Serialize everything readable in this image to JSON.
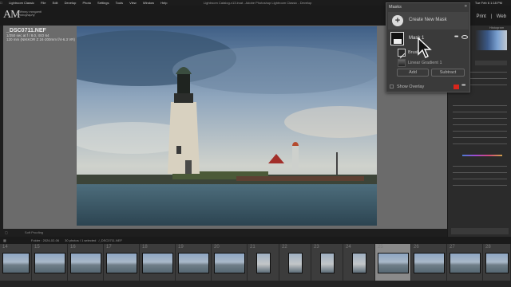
{
  "menubar": {
    "items": [
      "Lightroom Classic",
      "File",
      "Edit",
      "Develop",
      "Photo",
      "Settings",
      "Tools",
      "View",
      "Window",
      "Help"
    ],
    "window_title": "Lightroom Catalog-v13.lrcat - Adobe Photoshop Lightroom Classic - Develop",
    "clock": "Tue Feb 6  1:18 PM"
  },
  "identity": {
    "logo_letters": "AM",
    "logo_line1": "anthony morganti",
    "logo_line2": "Photography"
  },
  "modules": {
    "print": "Print",
    "web": "Web"
  },
  "info_overlay": {
    "filename": "_DSC0711.NEF",
    "exposure": "1/250 sec at f / 8.0, ISO 64",
    "lens": "120 mm (NIKKOR Z 24-200mm f/4-6.3 VR)"
  },
  "masks_panel": {
    "title": "Masks",
    "create_label": "Create New Mask",
    "mask_label": "Mask 1",
    "brush_label": "Brush",
    "linear_label": "Linear Gradient 1",
    "add_label": "Add",
    "subtract_label": "Subtract",
    "show_overlay_label": "Show Overlay",
    "overlay_color": "#d9261c"
  },
  "right_panel": {
    "histogram_label": "Histogram"
  },
  "toolbar": {
    "soft_proof": "Soft Proofing"
  },
  "filmstrip_bar": {
    "folder": "Folder : 2024-02-06",
    "count": "30 photos / 1 selected",
    "current": "/_DSC0711.NEF"
  },
  "filmstrip": {
    "numbers": [
      "14",
      "15",
      "16",
      "17",
      "18",
      "19",
      "20",
      "21",
      "22",
      "23",
      "24",
      "25",
      "26",
      "27",
      "28",
      "29"
    ],
    "selected_index": 11
  }
}
